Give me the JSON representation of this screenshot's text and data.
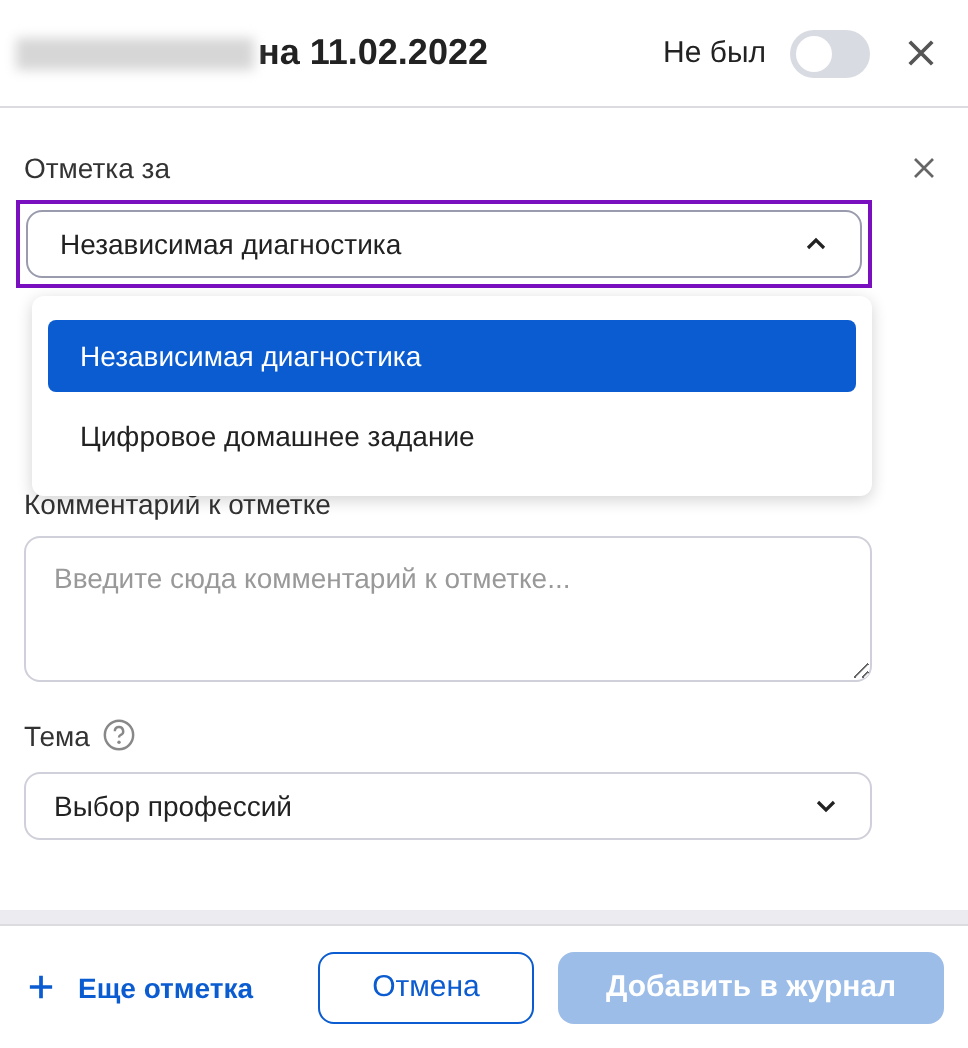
{
  "header": {
    "title": "на 11.02.2022",
    "absent_label": "Не был",
    "absent_on": false
  },
  "mark_for": {
    "label": "Отметка за",
    "value": "Независимая диагностика",
    "expanded": true,
    "options": [
      {
        "label": "Независимая диагностика",
        "selected": true
      },
      {
        "label": "Цифровое домашнее задание",
        "selected": false
      }
    ]
  },
  "comment": {
    "label": "Комментарий к отметке",
    "placeholder": "Введите сюда комментарий к отметке..."
  },
  "topic": {
    "label": "Тема",
    "value": "Выбор профессий"
  },
  "footer": {
    "add_more": "Еще отметка",
    "cancel": "Отмена",
    "submit": "Добавить в журнал",
    "submit_disabled": true
  }
}
